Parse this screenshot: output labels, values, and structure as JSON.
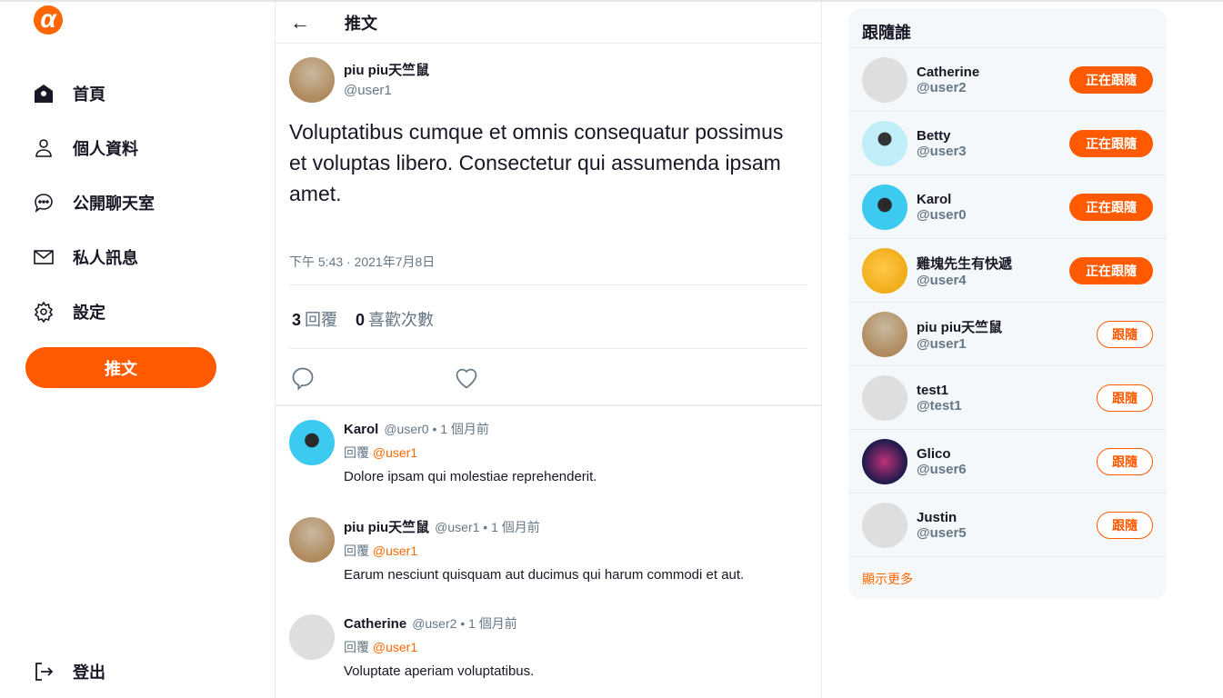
{
  "sidebar": {
    "logo": "α",
    "items": [
      {
        "label": "首頁",
        "icon": "home-icon"
      },
      {
        "label": "個人資料",
        "icon": "user-icon"
      },
      {
        "label": "公開聊天室",
        "icon": "chat-icon"
      },
      {
        "label": "私人訊息",
        "icon": "mail-icon"
      },
      {
        "label": "設定",
        "icon": "gear-icon"
      }
    ],
    "tweet_button": "推文",
    "logout": "登出"
  },
  "header": {
    "title": "推文"
  },
  "post": {
    "name": "piu piu天竺鼠",
    "handle": "@user1",
    "text": "Voluptatibus cumque et omnis consequatur possimus et voluptas libero. Consectetur qui assumenda ipsam amet.",
    "time": "下午 5:43 · 2021年7月8日",
    "reply_count": "3",
    "reply_label": "回覆",
    "like_count": "0",
    "like_label": "喜歡次數"
  },
  "replies": [
    {
      "name": "Karol",
      "handle": "@user0",
      "time": "• 1 個月前",
      "reply_prefix": "回覆",
      "reply_to": "@user1",
      "text": "Dolore ipsam qui molestiae reprehenderit."
    },
    {
      "name": "piu piu天竺鼠",
      "handle": "@user1",
      "time": "• 1 個月前",
      "reply_prefix": "回覆",
      "reply_to": "@user1",
      "text": "Earum nesciunt quisquam aut ducimus qui harum commodi et aut."
    },
    {
      "name": "Catherine",
      "handle": "@user2",
      "time": "• 1 個月前",
      "reply_prefix": "回覆",
      "reply_to": "@user1",
      "text": "Voluptate aperiam voluptatibus."
    }
  ],
  "follow": {
    "title": "跟隨誰",
    "show_more": "顯示更多",
    "users": [
      {
        "name": "Catherine",
        "handle": "@user2",
        "button": "正在跟隨"
      },
      {
        "name": "Betty",
        "handle": "@user3",
        "button": "正在跟隨"
      },
      {
        "name": "Karol",
        "handle": "@user0",
        "button": "正在跟隨"
      },
      {
        "name": "雞塊先生有快遞",
        "handle": "@user4",
        "button": "正在跟隨"
      },
      {
        "name": "piu piu天竺鼠",
        "handle": "@user1",
        "button": "跟隨"
      },
      {
        "name": "test1",
        "handle": "@test1",
        "button": "跟隨"
      },
      {
        "name": "Glico",
        "handle": "@user6",
        "button": "跟隨"
      },
      {
        "name": "Justin",
        "handle": "@user5",
        "button": "跟隨"
      }
    ]
  },
  "colors": {
    "accent": "#ff5a00",
    "muted": "#657786"
  }
}
